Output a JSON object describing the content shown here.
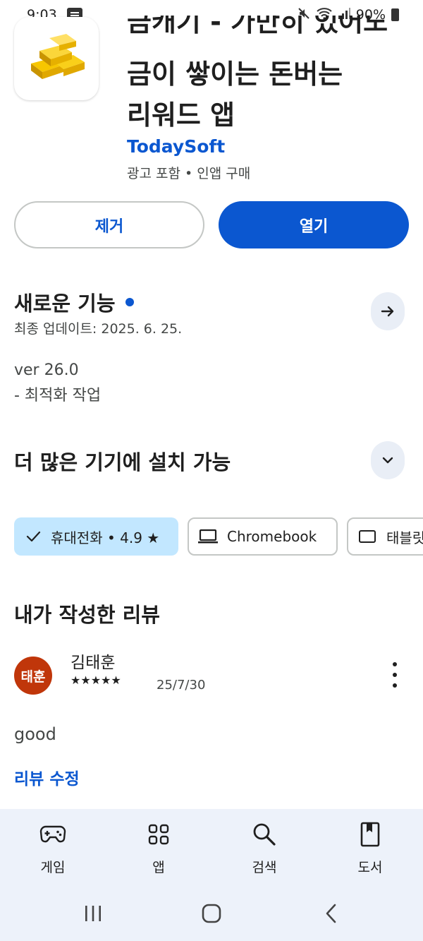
{
  "status_bar": {
    "time": "9:03",
    "battery": "90%"
  },
  "app": {
    "title_partial_line": "금캐기 - 가만히 있어도",
    "title_lines": [
      "금이 쌓이는 돈버는",
      "리워드 앱"
    ],
    "developer": "TodaySoft",
    "meta": "광고 포함 • 인앱 구매",
    "icon": "gold-bars-icon"
  },
  "actions": {
    "remove_label": "제거",
    "open_label": "열기"
  },
  "whats_new": {
    "title": "새로운 기능",
    "last_update": "최종 업데이트: 2025. 6. 25.",
    "notes": [
      "ver 26.0",
      "- 최적화 작업"
    ]
  },
  "devices": {
    "title": "더 많은 기기에 설치 가능",
    "chips": [
      {
        "label": "휴대전화 • 4.9 ★",
        "selected": true,
        "icon": "check-icon"
      },
      {
        "label": "Chromebook",
        "selected": false,
        "icon": "laptop-icon"
      },
      {
        "label": "태블릿",
        "selected": false,
        "icon": "tablet-icon"
      }
    ]
  },
  "my_review": {
    "title": "내가 작성한 리뷰",
    "avatar_text": "태훈",
    "avatar_color": "#c0360a",
    "reviewer": "김태훈",
    "rating": 5,
    "stars": "★★★★★",
    "date": "25/7/30",
    "text": "good",
    "edit_label": "리뷰 수정"
  },
  "bottom_nav": {
    "items": [
      {
        "label": "게임",
        "icon": "gamepad-icon"
      },
      {
        "label": "앱",
        "icon": "apps-grid-icon"
      },
      {
        "label": "검색",
        "icon": "search-icon"
      },
      {
        "label": "도서",
        "icon": "book-icon"
      }
    ]
  },
  "colors": {
    "accent": "#0b57d0",
    "chip_selected": "#c2e7ff",
    "nav_bg": "#edf2fa"
  }
}
